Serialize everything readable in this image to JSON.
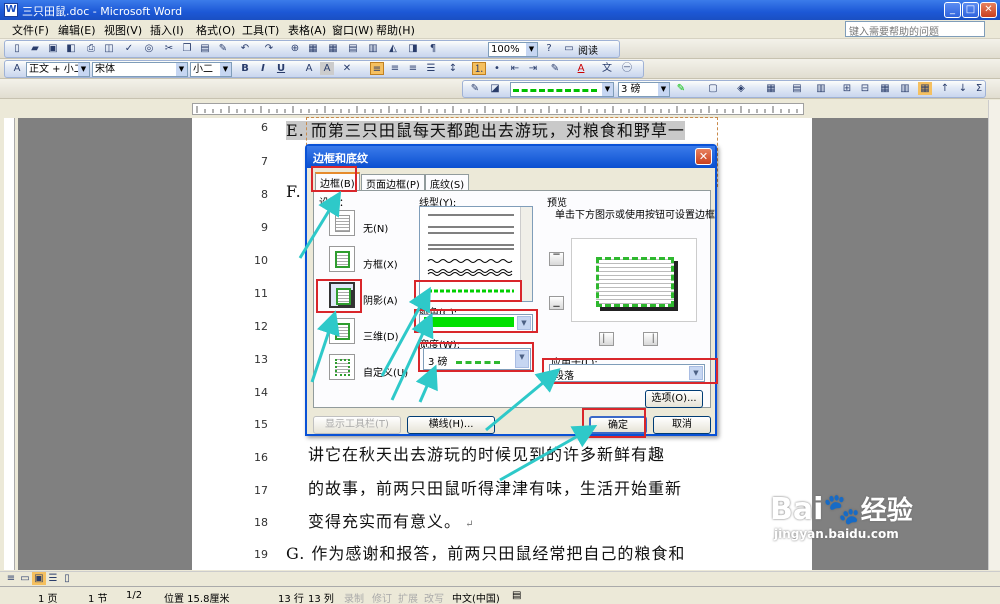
{
  "window": {
    "title": "三只田鼠.doc - Microsoft Word",
    "min": "_",
    "max": "□",
    "close": "✕"
  },
  "menu": [
    "文件(F)",
    "编辑(E)",
    "视图(V)",
    "插入(I)",
    "格式(O)",
    "工具(T)",
    "表格(A)",
    "窗口(W)",
    "帮助(H)"
  ],
  "help_placeholder": "键入需要帮助的问题",
  "toolbar": {
    "zoom": "100%",
    "read": "阅读",
    "style": "正文 + 小二",
    "font": "宋体",
    "size": "小二",
    "bold": "B",
    "italic": "I",
    "underline": "U",
    "border_width": "3 磅"
  },
  "document": {
    "line_numbers": [
      "6",
      "7",
      "8",
      "9",
      "10",
      "11",
      "12",
      "13",
      "14",
      "15",
      "16",
      "17",
      "18",
      "19"
    ],
    "line_e": "E. 而第三只田鼠每天都跑出去游玩，对粮食和野草一",
    "line_f": "F.",
    "line_16": "讲它在秋天出去游玩的时候见到的许多新鲜有趣",
    "line_17": "的故事，前两只田鼠听得津津有味，生活开始重新",
    "line_18": "变得充实而有意义。",
    "line_g": "G. 作为感谢和报答，前两只田鼠经常把自己的粮食和"
  },
  "dialog": {
    "title": "边框和底纹",
    "tabs": [
      "边框(B)",
      "页面边框(P)",
      "底纹(S)"
    ],
    "settings_label": "设置：",
    "settings": [
      "无(N)",
      "方框(X)",
      "阴影(A)",
      "三维(D)",
      "自定义(U)"
    ],
    "line_style_label": "线型(Y):",
    "color_label": "颜色(C):",
    "width_label": "宽度(W):",
    "width_value": "3 磅",
    "preview_label": "预览",
    "preview_hint": "单击下方图示或使用按钮可设置边框",
    "apply_label": "应用于(L):",
    "apply_value": "段落",
    "options_button": "选项(O)...",
    "show_toolbar_button": "显示工具栏(T)",
    "horizontal_line_button": "横线(H)...",
    "ok_button": "确定",
    "cancel_button": "取消"
  },
  "status": {
    "page": "1 页",
    "section": "1 节",
    "pages": "1/2",
    "position": "位置 15.8厘米",
    "row": "13 行",
    "col": "13 列",
    "rec": "录制",
    "trk": "修订",
    "ext": "扩展",
    "ovr": "改写",
    "lang": "中文(中国)"
  },
  "watermark": {
    "brand": "Bai",
    "brand2": "经验",
    "url": "jingyan.baidu.com"
  },
  "colors": {
    "accent_green": "#00e000",
    "highlight_red": "#d9262b",
    "arrow_cyan": "#2ec9c9",
    "title_blue": "#1c58d6"
  }
}
